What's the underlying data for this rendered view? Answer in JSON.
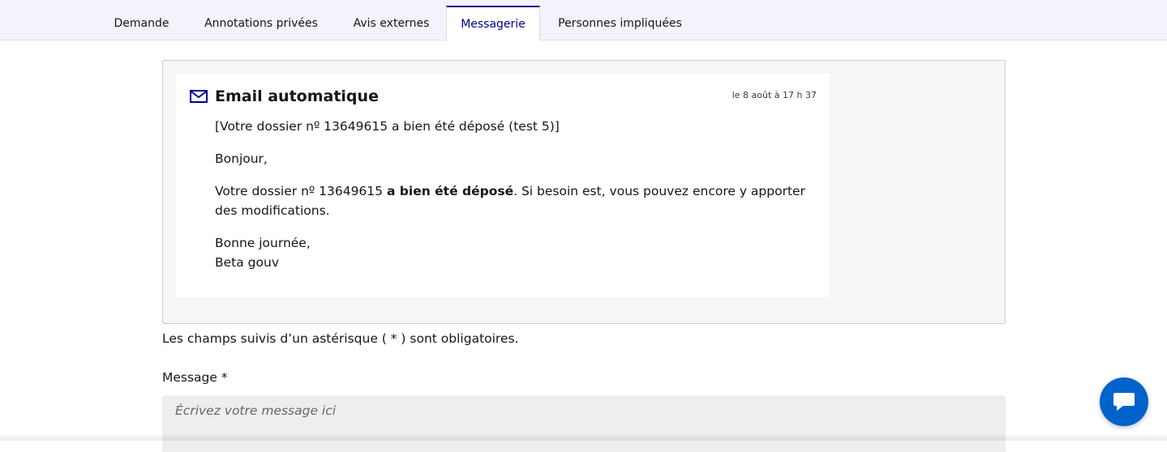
{
  "tabs": [
    {
      "label": "Demande",
      "active": false
    },
    {
      "label": "Annotations privées",
      "active": false
    },
    {
      "label": "Avis externes",
      "active": false
    },
    {
      "label": "Messagerie",
      "active": true
    },
    {
      "label": "Personnes impliquées",
      "active": false
    }
  ],
  "message": {
    "icon": "mail-icon",
    "title": "Email automatique",
    "date": "le 8 août à 17 h 37",
    "subject": "[Votre dossier nº 13649615 a bien été déposé (test 5)]",
    "greeting": "Bonjour,",
    "body_prefix": "Votre dossier nº 13649615 ",
    "body_bold": "a bien été déposé",
    "body_suffix": ". Si besoin est, vous pouvez encore y apporter des modifications.",
    "closing": "Bonne journée,",
    "signature": "Beta gouv"
  },
  "form": {
    "required_hint": "Les champs suivis d’un astérisque ( * ) sont obligatoires.",
    "message_label": "Message *",
    "message_placeholder": "Écrivez votre message ici"
  },
  "chat_button": {
    "icon": "chat-bubble-icon"
  },
  "colors": {
    "accent": "#000091",
    "tabbar_bg": "#f4f3fb",
    "thread_bg": "#f6f6f6",
    "chat_button": "#0063cb"
  }
}
